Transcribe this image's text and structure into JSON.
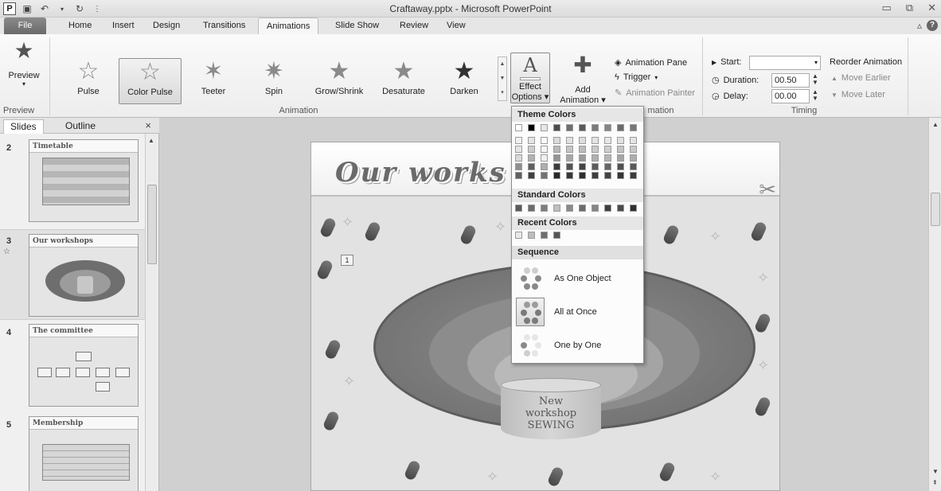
{
  "window": {
    "title": "Craftaway.pptx - Microsoft PowerPoint",
    "app_icon_letter": "P"
  },
  "tabs": [
    "File",
    "Home",
    "Insert",
    "Design",
    "Transitions",
    "Animations",
    "Slide Show",
    "Review",
    "View"
  ],
  "active_tab": "Animations",
  "ribbon": {
    "preview_label": "Preview",
    "preview_group": "Preview",
    "animation_group": "Animation",
    "advanced_group_partial": "mation",
    "timing_group": "Timing",
    "effects": [
      "Pulse",
      "Color Pulse",
      "Teeter",
      "Spin",
      "Grow/Shrink",
      "Desaturate",
      "Darken"
    ],
    "selected_effect": "Color Pulse",
    "effect_options_line1": "Effect",
    "effect_options_line2": "Options",
    "add_animation_line1": "Add",
    "add_animation_line2": "Animation",
    "animation_pane": "Animation Pane",
    "trigger": "Trigger",
    "animation_painter": "Animation Painter",
    "start_label": "Start:",
    "start_value": "",
    "duration_label": "Duration:",
    "duration_value": "00.50",
    "delay_label": "Delay:",
    "delay_value": "00.00",
    "reorder_title": "Reorder Animation",
    "move_earlier": "Move Earlier",
    "move_later": "Move Later"
  },
  "left_pane": {
    "tabs": [
      "Slides",
      "Outline"
    ],
    "close_glyph": "×",
    "thumbnails": [
      {
        "number": "2",
        "title": "Timetable"
      },
      {
        "number": "3",
        "title": "Our workshops"
      },
      {
        "number": "4",
        "title": "The committee"
      },
      {
        "number": "5",
        "title": "Membership"
      }
    ]
  },
  "slide": {
    "title": "Our works",
    "cylinder_text_1": "New",
    "cylinder_text_2": "workshop",
    "cylinder_text_3": "SEWING",
    "animation_tag": "1"
  },
  "dropdown": {
    "theme_colors_heading": "Theme Colors",
    "standard_colors_heading": "Standard Colors",
    "recent_colors_heading": "Recent Colors",
    "sequence_heading": "Sequence",
    "seq_as_one_object": "As One Object",
    "seq_all_at_once": "All at Once",
    "seq_one_by_one": "One by One",
    "theme_top_row": [
      "#ffffff",
      "#000000",
      "#e6e6e6",
      "#4d4d4d",
      "#6e6e6e",
      "#5a5a5a",
      "#7a7a7a",
      "#858585",
      "#6b6b6b",
      "#777777"
    ],
    "standard_colors": [
      "#5a5a5a",
      "#6b6b6b",
      "#7d7d7d",
      "#bfbfbf",
      "#8a8a8a",
      "#6a6a6a",
      "#858585",
      "#3e3e3e",
      "#4a4a4a",
      "#2e2e2e"
    ],
    "recent_colors": [
      "#e8e8e8",
      "#bdbdbd",
      "#6f6f6f",
      "#555555"
    ]
  }
}
